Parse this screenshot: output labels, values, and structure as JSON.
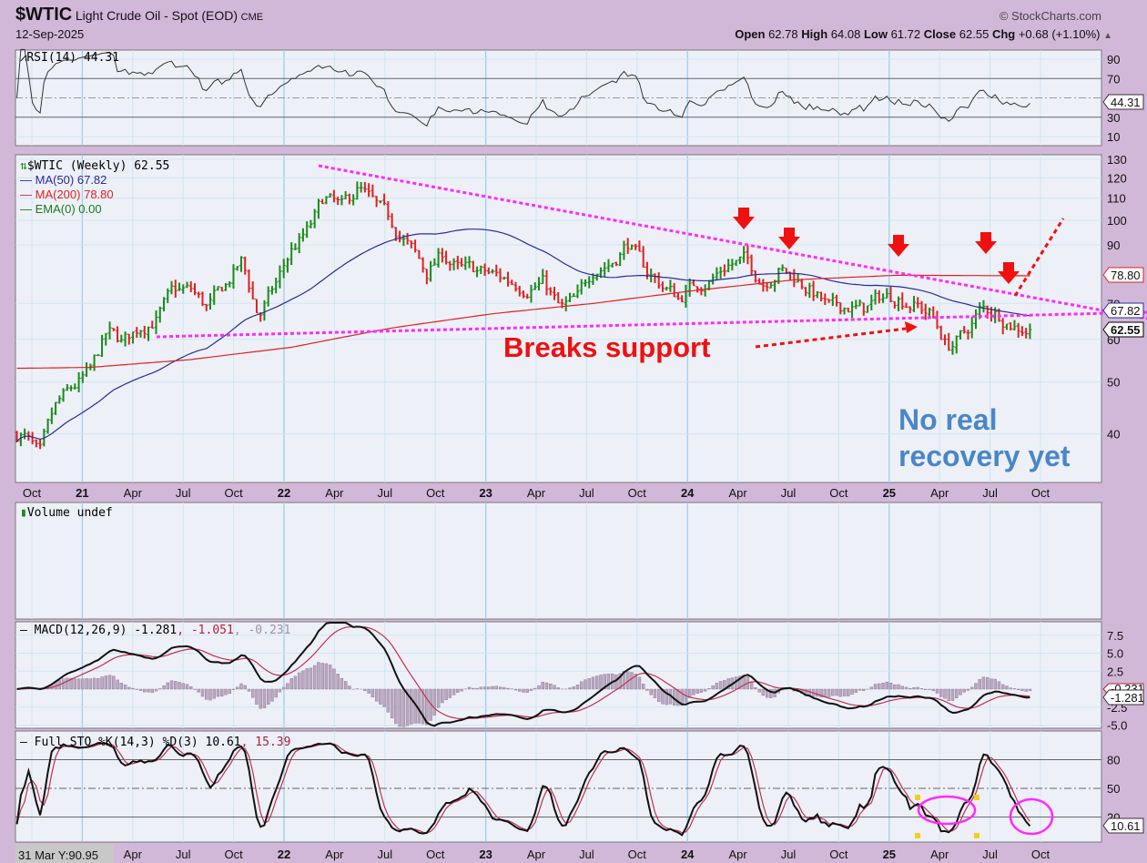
{
  "header": {
    "symbol": "$WTIC",
    "name": "Light Crude Oil - Spot (EOD)",
    "exchange": "CME",
    "date": "12-Sep-2025",
    "copyright": "© StockCharts.com",
    "open_label": "Open",
    "open": "62.78",
    "high_label": "High",
    "high": "64.08",
    "low_label": "Low",
    "low": "61.72",
    "close_label": "Close",
    "close": "62.55",
    "chg_label": "Chg",
    "chg": "+0.68 (+1.10%)",
    "chg_arrow": "▲"
  },
  "rsi": {
    "legend": "RSI(14) 44.31",
    "ticks": [
      "90",
      "70",
      "50",
      "30",
      "10"
    ],
    "value_tag": "44.31"
  },
  "main": {
    "legend": "$WTIC (Weekly) 62.55",
    "ma50": "MA(50) 67.82",
    "ma200": "MA(200) 78.80",
    "ema": "EMA(0) 0.00",
    "ticks": [
      "130",
      "120",
      "110",
      "100",
      "90",
      "70",
      "60",
      "50",
      "40"
    ],
    "tag_ma200": "78.80",
    "tag_ma50": "67.82",
    "tag_close": "62.55"
  },
  "volume": {
    "legend": "Volume undef"
  },
  "macd": {
    "legend": "MACD(12,26,9) -1.281",
    "signal": ", -1.051",
    "hist": ", -0.231",
    "ticks": [
      "7.5",
      "5.0",
      "2.5",
      "-2.5",
      "-5.0"
    ],
    "tag": "-1.281",
    "tag_hidden": "-0.231"
  },
  "sto": {
    "legend": "Full STO %K(14,3) %D(3) 10.61",
    "d": ", 15.39",
    "ticks": [
      "80",
      "50",
      "20"
    ],
    "tag": "10.61"
  },
  "x_axis": {
    "labels": [
      "Oct",
      "21",
      "Apr",
      "Jul",
      "Oct",
      "22",
      "Apr",
      "Jul",
      "Oct",
      "23",
      "Apr",
      "Jul",
      "Oct",
      "24",
      "Apr",
      "Jul",
      "Oct",
      "25",
      "Apr",
      "Jul",
      "Oct"
    ],
    "cursor_readout": "31 Mar Y:90.95"
  },
  "annotations": {
    "breaks": "Breaks support",
    "recovery1": "No real",
    "recovery2": "recovery yet"
  },
  "colors": {
    "up": "#1a8a1a",
    "down": "#e0201e",
    "ma50": "#2a2a9a",
    "ma200": "#e02020",
    "trend": "#ff2aff",
    "annot_red": "#f01010",
    "annot_blue": "#4a86c8"
  },
  "chart_data": {
    "type": "line",
    "title": "$WTIC Light Crude Oil - Spot (Weekly)",
    "yscale": "log",
    "ylim": [
      32.5,
      135
    ],
    "months": [
      "2020-09",
      "2020-10",
      "2020-11",
      "2020-12",
      "2021-01",
      "2021-02",
      "2021-03",
      "2021-04",
      "2021-05",
      "2021-06",
      "2021-07",
      "2021-08",
      "2021-09",
      "2021-10",
      "2021-11",
      "2021-12",
      "2022-01",
      "2022-02",
      "2022-03",
      "2022-04",
      "2022-05",
      "2022-06",
      "2022-07",
      "2022-08",
      "2022-09",
      "2022-10",
      "2022-11",
      "2022-12",
      "2023-01",
      "2023-02",
      "2023-03",
      "2023-04",
      "2023-05",
      "2023-06",
      "2023-07",
      "2023-08",
      "2023-09",
      "2023-10",
      "2023-11",
      "2023-12",
      "2024-01",
      "2024-02",
      "2024-03",
      "2024-04",
      "2024-05",
      "2024-06",
      "2024-07",
      "2024-08",
      "2024-09",
      "2024-10",
      "2024-11",
      "2024-12",
      "2025-01",
      "2025-02",
      "2025-03",
      "2025-04",
      "2025-05",
      "2025-06",
      "2025-07",
      "2025-08",
      "2025-09"
    ],
    "closes": [
      40,
      36,
      45,
      48.5,
      52,
      61.5,
      59,
      63.5,
      66,
      73.5,
      73.9,
      68.5,
      75,
      83.5,
      66,
      75,
      88,
      95.7,
      110,
      104.7,
      114.7,
      105.8,
      98.6,
      89.5,
      79.5,
      86.5,
      80.5,
      80.3,
      78.9,
      77,
      75.7,
      76.8,
      68,
      70.6,
      81.8,
      83.6,
      90.8,
      81,
      75.9,
      71.7,
      75.8,
      78.3,
      83.2,
      84,
      76.9,
      81.5,
      77.9,
      73.6,
      68.2,
      69.3,
      68,
      71.7,
      72.5,
      69.8,
      67,
      58.2,
      60.8,
      68,
      67.3,
      64,
      62.55
    ],
    "ma200": {
      "months": [
        "2020-09",
        "2021-01",
        "2021-07",
        "2022-01",
        "2022-07",
        "2023-01",
        "2023-07",
        "2024-01",
        "2024-07",
        "2025-01",
        "2025-09"
      ],
      "values": [
        53,
        53.2,
        55,
        58,
        63,
        67,
        70,
        74,
        77.5,
        79,
        78.8
      ]
    },
    "last": {
      "close": 62.55,
      "ma50": 67.82,
      "ma200": 78.8,
      "rsi": 44.31,
      "macd": -1.281,
      "signal": -1.051,
      "hist": -0.231,
      "sto_k": 10.61,
      "sto_d": 15.39
    }
  }
}
